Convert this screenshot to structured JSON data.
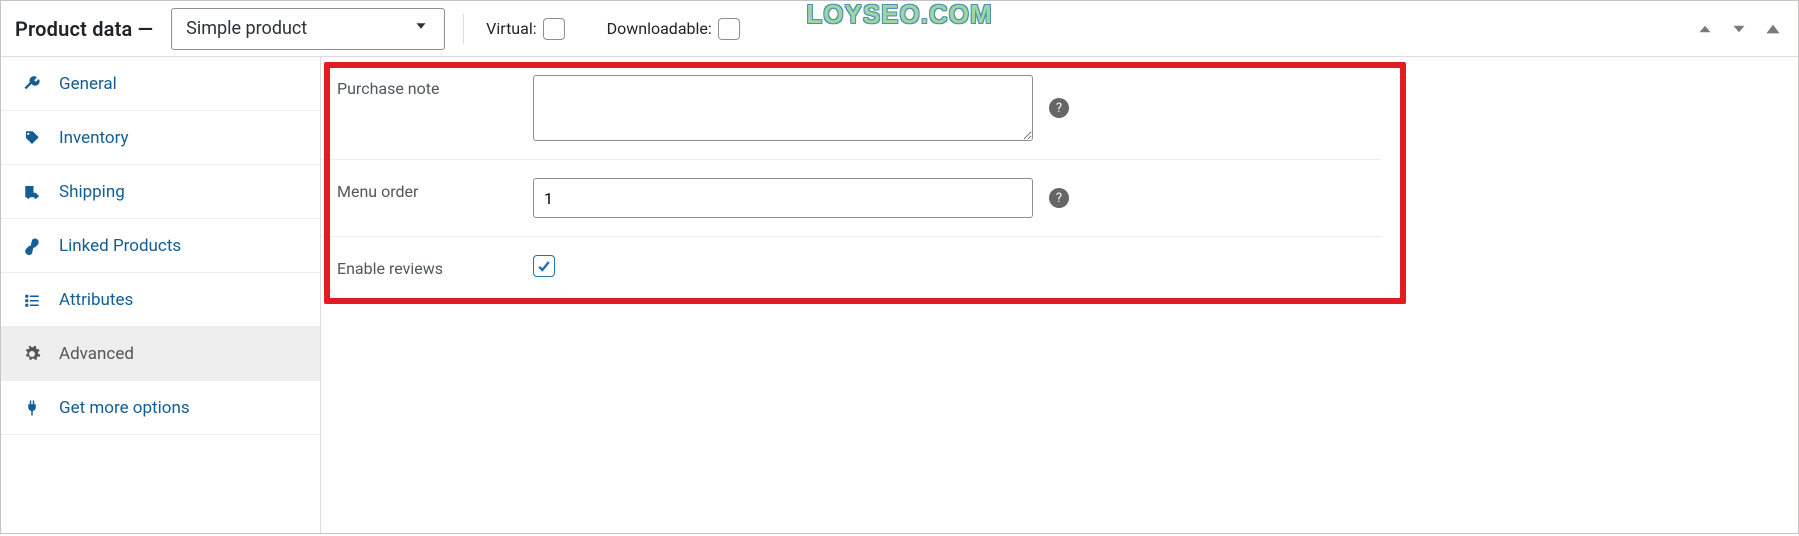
{
  "header": {
    "title": "Product data —",
    "product_type": "Simple product",
    "virtual_label": "Virtual:",
    "virtual_checked": false,
    "downloadable_label": "Downloadable:",
    "downloadable_checked": false
  },
  "watermark": "LOYSEO.COM",
  "tabs": [
    {
      "id": "general",
      "label": "General",
      "icon": "wrench"
    },
    {
      "id": "inventory",
      "label": "Inventory",
      "icon": "tag"
    },
    {
      "id": "shipping",
      "label": "Shipping",
      "icon": "truck"
    },
    {
      "id": "linked",
      "label": "Linked Products",
      "icon": "link"
    },
    {
      "id": "attributes",
      "label": "Attributes",
      "icon": "list"
    },
    {
      "id": "advanced",
      "label": "Advanced",
      "icon": "gear",
      "active": true
    },
    {
      "id": "more",
      "label": "Get more options",
      "icon": "plug"
    }
  ],
  "advanced": {
    "purchase_note_label": "Purchase note",
    "purchase_note_value": "",
    "menu_order_label": "Menu order",
    "menu_order_value": "1",
    "enable_reviews_label": "Enable reviews",
    "enable_reviews_checked": true
  }
}
